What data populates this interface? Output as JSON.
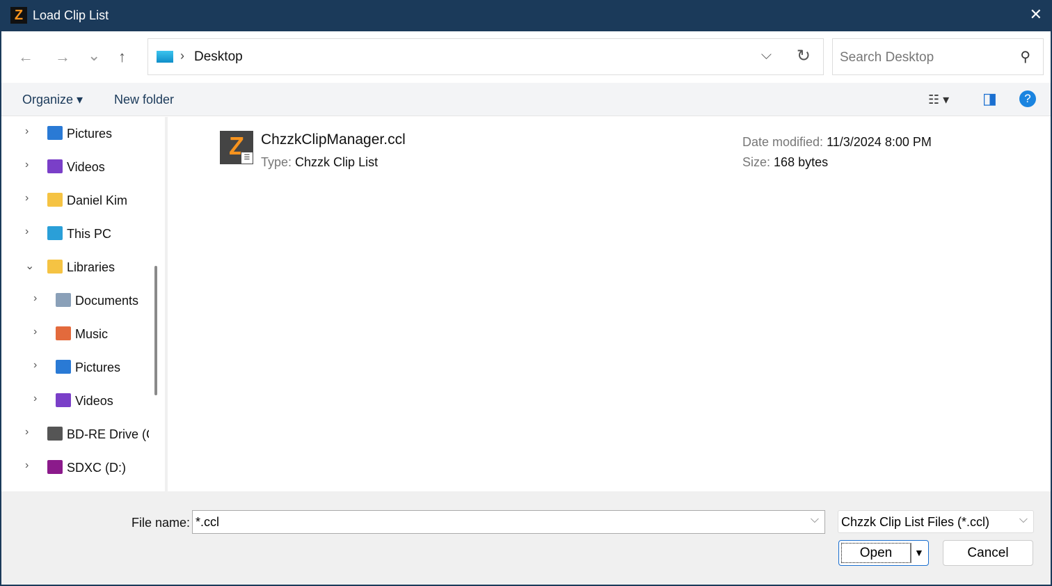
{
  "window": {
    "title": "Load Clip List",
    "close": "✕",
    "app_icon": "Z"
  },
  "nav": {
    "back": "←",
    "forward": "→",
    "recent": "⌄",
    "up": "↑",
    "breadcrumb": "Desktop",
    "breadcrumb_sep": "›",
    "dropdown": "⌵",
    "refresh": "↻"
  },
  "search": {
    "placeholder": "Search Desktop",
    "icon": "⚲"
  },
  "toolbar": {
    "organize": "Organize ▾",
    "new_folder": "New folder",
    "view": "☷ ▾",
    "pane": "◨",
    "help": "?"
  },
  "sidebar": {
    "items": [
      {
        "label": "Pictures",
        "chevron": "›",
        "icon": "pictures",
        "color": "#2a7ad5"
      },
      {
        "label": "Videos",
        "chevron": "›",
        "icon": "videos",
        "color": "#7a3fc8"
      },
      {
        "label": "Daniel Kim",
        "chevron": "›",
        "icon": "folder",
        "color": "#f5c343"
      },
      {
        "label": "This PC",
        "chevron": "›",
        "icon": "monitor",
        "color": "#2a9fd8"
      },
      {
        "label": "Libraries",
        "chevron": "⌄",
        "icon": "folder",
        "color": "#f5c343"
      },
      {
        "label": "Documents",
        "chevron": "›",
        "icon": "documents",
        "color": "#8aa0b8"
      },
      {
        "label": "Music",
        "chevron": "›",
        "icon": "music",
        "color": "#e36a3c"
      },
      {
        "label": "Pictures",
        "chevron": "›",
        "icon": "pictures",
        "color": "#2a7ad5"
      },
      {
        "label": "Videos",
        "chevron": "›",
        "icon": "videos",
        "color": "#7a3fc8"
      },
      {
        "label": "BD-RE Drive (G",
        "chevron": "›",
        "icon": "disc-drive",
        "color": "#555555"
      },
      {
        "label": "SDXC (D:)",
        "chevron": "›",
        "icon": "sd-card",
        "color": "#8b1a8b"
      }
    ]
  },
  "file": {
    "name": "ChzzkClipManager.ccl",
    "type_label": "Type:",
    "type": "Chzzk Clip List",
    "date_label": "Date modified:",
    "date": "11/3/2024 8:00 PM",
    "size_label": "Size:",
    "size": "168 bytes",
    "icon_letter": "Z",
    "badge": "☰"
  },
  "footer": {
    "file_name_label": "File name:",
    "file_name": "*.ccl",
    "filter": "Chzzk Clip List Files (*.ccl)",
    "open": "Open",
    "open_split": "▼",
    "cancel": "Cancel",
    "chevron": "⌵"
  }
}
